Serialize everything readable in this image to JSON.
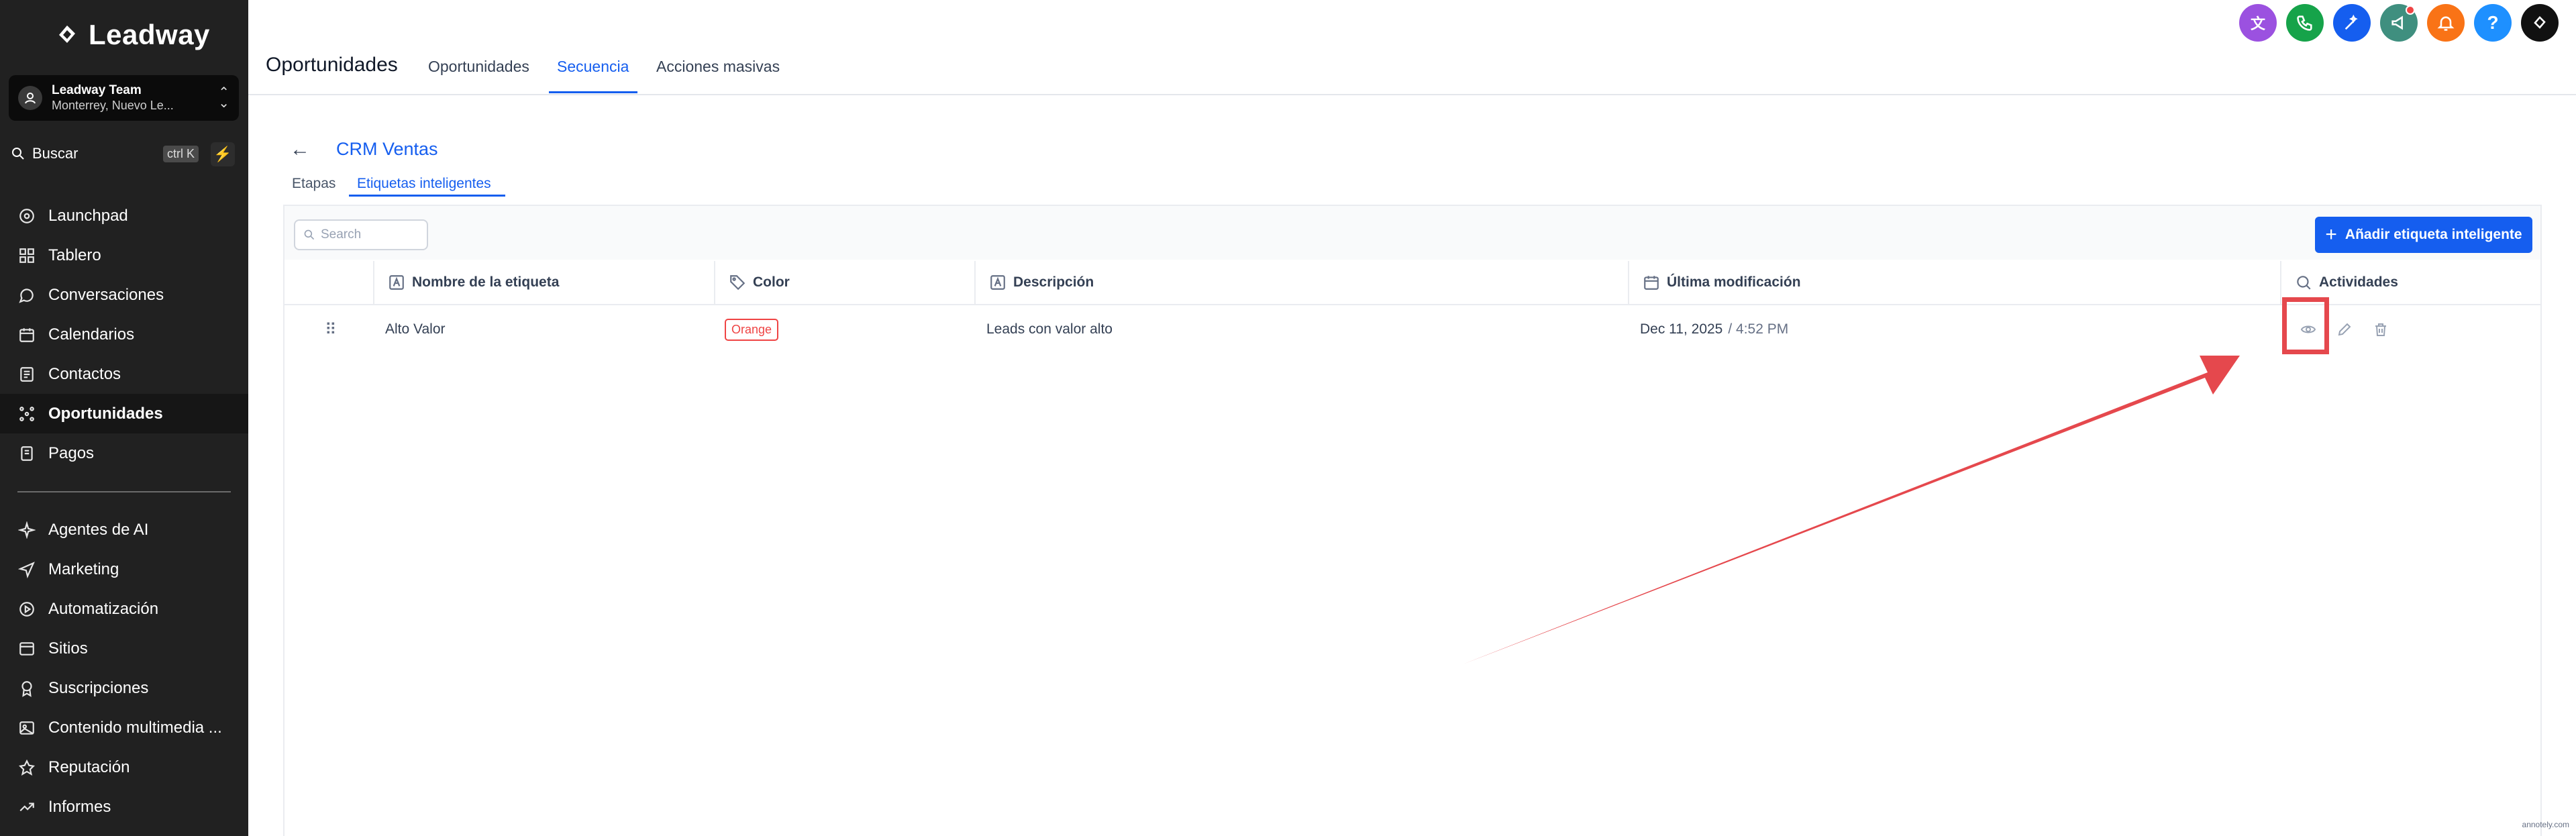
{
  "brand": {
    "name": "Leadway"
  },
  "team": {
    "name": "Leadway Team",
    "location": "Monterrey, Nuevo Le..."
  },
  "search": {
    "label": "Buscar",
    "shortcut": "ctrl K"
  },
  "sidebar": {
    "items": [
      {
        "label": "Launchpad",
        "icon": "launchpad-icon"
      },
      {
        "label": "Tablero",
        "icon": "dashboard-icon"
      },
      {
        "label": "Conversaciones",
        "icon": "chat-icon"
      },
      {
        "label": "Calendarios",
        "icon": "calendar-icon"
      },
      {
        "label": "Contactos",
        "icon": "contacts-icon"
      },
      {
        "label": "Oportunidades",
        "icon": "opportunities-icon",
        "active": true
      },
      {
        "label": "Pagos",
        "icon": "payments-icon"
      }
    ],
    "items2": [
      {
        "label": "Agentes de AI",
        "icon": "sparkle-icon"
      },
      {
        "label": "Marketing",
        "icon": "send-icon"
      },
      {
        "label": "Automatización",
        "icon": "automation-icon"
      },
      {
        "label": "Sitios",
        "icon": "sites-icon"
      },
      {
        "label": "Suscripciones",
        "icon": "award-icon"
      },
      {
        "label": "Contenido multimedia ...",
        "icon": "image-icon"
      },
      {
        "label": "Reputación",
        "icon": "star-icon"
      },
      {
        "label": "Informes",
        "icon": "trend-icon"
      }
    ]
  },
  "header": {
    "title": "Oportunidades",
    "tabs": [
      "Oportunidades",
      "Secuencia",
      "Acciones masivas"
    ],
    "active_tab": "Secuencia",
    "icon_colors": [
      "#9b51e0",
      "#16a34a",
      "#155eef",
      "#3f8f7f",
      "#f97316",
      "#1e90ff",
      "#111111"
    ]
  },
  "crm": {
    "title": "CRM Ventas",
    "subtabs": [
      "Etapas",
      "Etiquetas inteligentes"
    ],
    "active_subtab": "Etiquetas inteligentes"
  },
  "table": {
    "search_placeholder": "Search",
    "add_button": "Añadir etiqueta inteligente",
    "columns": [
      "Nombre de la etiqueta",
      "Color",
      "Descripción",
      "Última modificación",
      "Actividades"
    ],
    "rows": [
      {
        "name": "Alto Valor",
        "color": "Orange",
        "description": "Leads con valor alto",
        "date": "Dec 11, 2025",
        "time": "/ 4:52 PM"
      }
    ]
  },
  "watermark": "annotely.com",
  "colors": {
    "accent": "#155eef",
    "sidebar_bg": "#212121",
    "annotation_red": "#e5484d"
  }
}
